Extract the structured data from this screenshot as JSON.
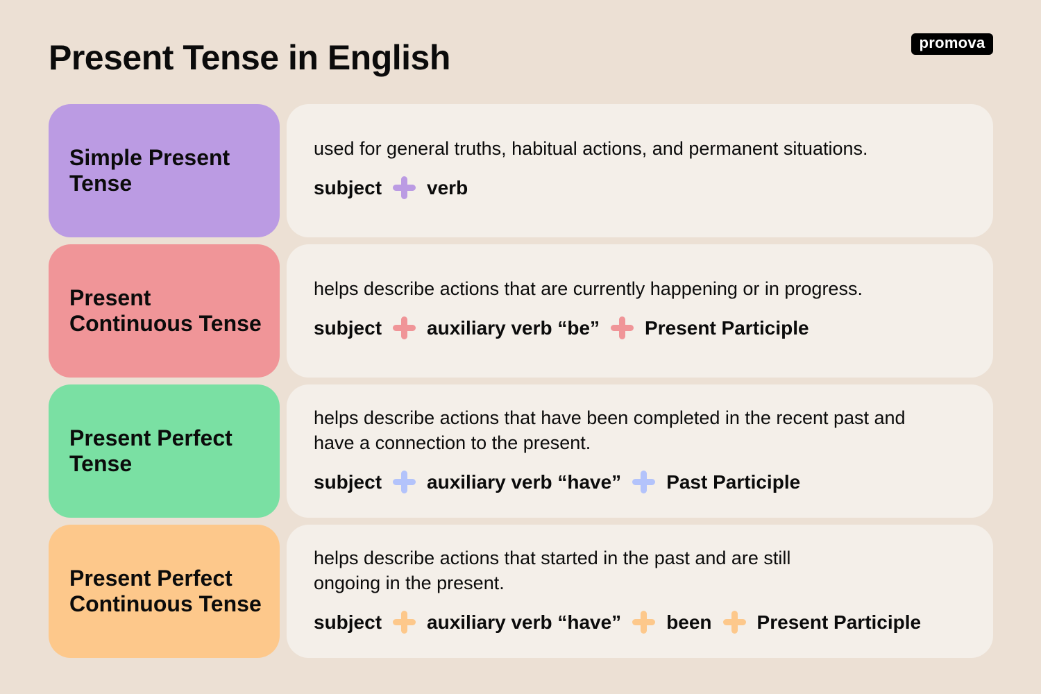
{
  "title": "Present Tense in English",
  "logo": "promova",
  "rows": [
    {
      "tag": "Simple Present Tense",
      "tag_color": "#bb9be3",
      "plus_color": "#bb9be3",
      "description": "used for general truths, habitual actions, and permanent situations.",
      "formula": [
        "subject",
        "verb"
      ]
    },
    {
      "tag": "Present Continuous Tense",
      "tag_color": "#f09598",
      "plus_color": "#f09598",
      "description": "helps describe actions that are currently happening or in progress.",
      "formula": [
        "subject",
        "auxiliary verb “be”",
        "Present Participle"
      ]
    },
    {
      "tag": "Present Perfect Tense",
      "tag_color": "#7ae0a3",
      "plus_color": "#b3c3fb",
      "description": "helps describe actions that have been completed in the recent past and have a connection to the present.",
      "formula": [
        "subject",
        "auxiliary verb “have”",
        "Past Participle"
      ]
    },
    {
      "tag": "Present Perfect Continuous Tense",
      "tag_color": "#fdc88b",
      "plus_color": "#fdc88b",
      "description": "helps describe actions that started in the past and are still ongoing in the present.",
      "formula": [
        "subject",
        "auxiliary verb “have”",
        "been",
        "Present Participle"
      ]
    }
  ]
}
